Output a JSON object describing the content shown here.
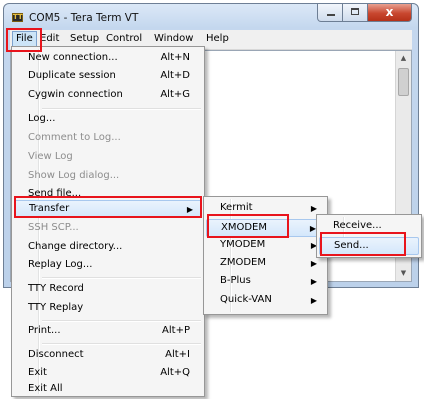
{
  "window": {
    "title": "COM5 - Tera Term VT",
    "icon": "teraterm-icon",
    "buttons": {
      "minimize": "minimize",
      "maximize": "maximize",
      "close": "x"
    }
  },
  "menubar": {
    "items": [
      "File",
      "Edit",
      "Setup",
      "Control",
      "Window",
      "Help"
    ],
    "active": "File"
  },
  "file_menu": {
    "items": [
      {
        "label": "New connection...",
        "shortcut": "Alt+N",
        "disabled": false
      },
      {
        "label": "Duplicate session",
        "shortcut": "Alt+D",
        "disabled": false
      },
      {
        "label": "Cygwin connection",
        "shortcut": "Alt+G",
        "disabled": false
      },
      {
        "label": "Log...",
        "shortcut": "",
        "disabled": false
      },
      {
        "label": "Comment to Log...",
        "shortcut": "",
        "disabled": true
      },
      {
        "label": "View Log",
        "shortcut": "",
        "disabled": true
      },
      {
        "label": "Show Log dialog...",
        "shortcut": "",
        "disabled": true
      },
      {
        "label": "Send file...",
        "shortcut": "",
        "disabled": false
      },
      {
        "label": "Transfer",
        "shortcut": "",
        "disabled": false,
        "submenu": true
      },
      {
        "label": "SSH SCP...",
        "shortcut": "",
        "disabled": true
      },
      {
        "label": "Change directory...",
        "shortcut": "",
        "disabled": false
      },
      {
        "label": "Replay Log...",
        "shortcut": "",
        "disabled": false
      },
      {
        "label": "TTY Record",
        "shortcut": "",
        "disabled": false
      },
      {
        "label": "TTY Replay",
        "shortcut": "",
        "disabled": false
      },
      {
        "label": "Print...",
        "shortcut": "Alt+P",
        "disabled": false
      },
      {
        "label": "Disconnect",
        "shortcut": "Alt+I",
        "disabled": false
      },
      {
        "label": "Exit",
        "shortcut": "Alt+Q",
        "disabled": false
      },
      {
        "label": "Exit All",
        "shortcut": "",
        "disabled": false
      }
    ]
  },
  "transfer_menu": {
    "items": [
      {
        "label": "Kermit",
        "submenu": true
      },
      {
        "label": "XMODEM",
        "submenu": true
      },
      {
        "label": "YMODEM",
        "submenu": true
      },
      {
        "label": "ZMODEM",
        "submenu": true
      },
      {
        "label": "B-Plus",
        "submenu": true
      },
      {
        "label": "Quick-VAN",
        "submenu": true
      }
    ]
  },
  "xmodem_menu": {
    "items": [
      {
        "label": "Receive..."
      },
      {
        "label": "Send..."
      }
    ]
  },
  "colors": {
    "highlight_box": "#e8141c",
    "menu_bg": "#f5f5f5",
    "title_bar": "#c4d7ee"
  }
}
